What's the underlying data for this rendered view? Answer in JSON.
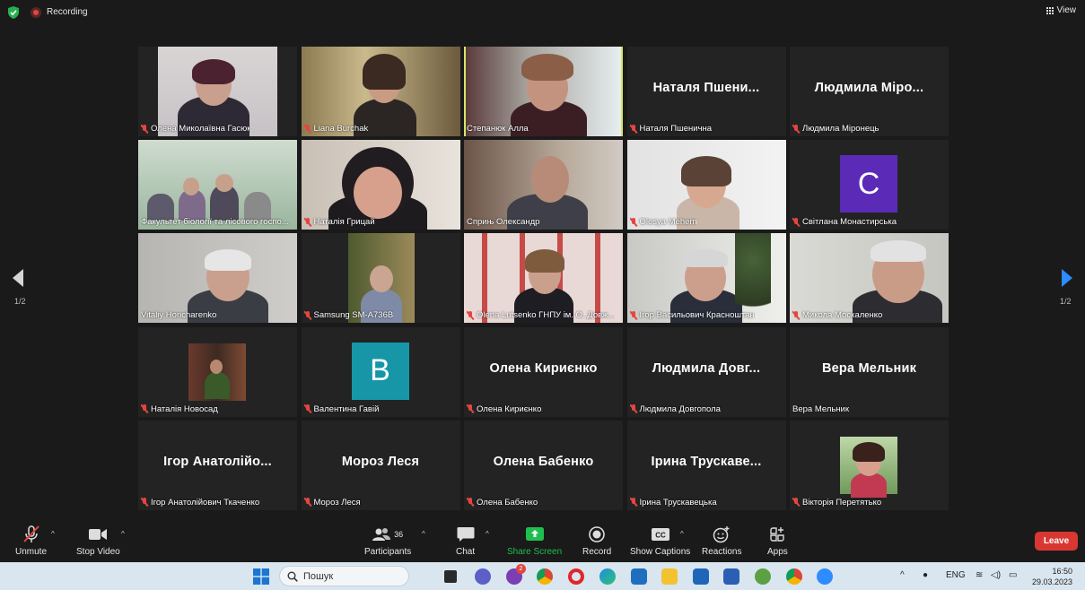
{
  "topbar": {
    "recording_label": "Recording",
    "view_label": "View"
  },
  "pager": {
    "left_page": "1/2",
    "right_page": "1/2"
  },
  "tiles": [
    {
      "name": "Олена Миколаївна Гасюк",
      "muted": true
    },
    {
      "name": "Liana Burchak",
      "muted": true
    },
    {
      "name": "Степанюк Алла",
      "muted": false,
      "active": true
    },
    {
      "name": "Наталя Пшенична",
      "big_name": "Наталя Пшени...",
      "muted": true
    },
    {
      "name": "Людмила Міронець",
      "big_name": "Людмила Міро...",
      "muted": true
    },
    {
      "name": "Факультет біології та лісового госпо...",
      "muted": false
    },
    {
      "name": "Наталія Грицай",
      "muted": true
    },
    {
      "name": "Сприњ Олександр",
      "muted": false
    },
    {
      "name": "Olesya Mehem",
      "muted": true
    },
    {
      "name": "Світлана Монастирська",
      "muted": true,
      "avatar_letter": "C",
      "avatar_color": "#5b2bb8"
    },
    {
      "name": "Vitaliy Honcharenko",
      "muted": false
    },
    {
      "name": "Samsung SM-A736B",
      "muted": true
    },
    {
      "name": "Olena Lutsenko ГНПУ ім. О. Довж...",
      "muted": true
    },
    {
      "name": "Ігор Васильович Красноштан",
      "muted": true
    },
    {
      "name": "Микола Москаленко",
      "muted": true
    },
    {
      "name": "Наталія Новосад",
      "muted": true
    },
    {
      "name": "Валентина Гавій",
      "muted": true,
      "avatar_letter": "B",
      "avatar_color": "#1796a8"
    },
    {
      "name": "Олена Кириєнко",
      "big_name": "Олена Кириєнко",
      "muted": true
    },
    {
      "name": "Людмила Довгопола",
      "big_name": "Людмила Довг...",
      "muted": true
    },
    {
      "name": "Вера Мельник",
      "big_name": "Вера Мельник",
      "muted": false
    },
    {
      "name": "Ігор Анатолійович Ткаченко",
      "big_name": "Ігор Анатолійо...",
      "muted": true
    },
    {
      "name": "Мороз Леся",
      "big_name": "Мороз Леся",
      "muted": true
    },
    {
      "name": "Олена Бабенко",
      "big_name": "Олена Бабенко",
      "muted": true
    },
    {
      "name": "Ірина Трускавецька",
      "big_name": "Ірина Трускаве...",
      "muted": true
    },
    {
      "name": "Вікторія Перетятько",
      "muted": true
    }
  ],
  "toolbar": {
    "unmute": "Unmute",
    "stop_video": "Stop Video",
    "participants": "Participants",
    "participants_count": "36",
    "chat": "Chat",
    "share_screen": "Share Screen",
    "record": "Record",
    "show_captions": "Show Captions",
    "reactions": "Reactions",
    "apps": "Apps",
    "leave": "Leave"
  },
  "taskbar": {
    "search_placeholder": "Пошук",
    "lang": "ENG",
    "time": "16:50",
    "date": "29.03.2023",
    "badge": "2"
  },
  "colors": {
    "accent_blue": "#2d8cff",
    "leave_red": "#d93832",
    "share_green": "#1fbf4f",
    "active_outline": "#d6e36b"
  }
}
